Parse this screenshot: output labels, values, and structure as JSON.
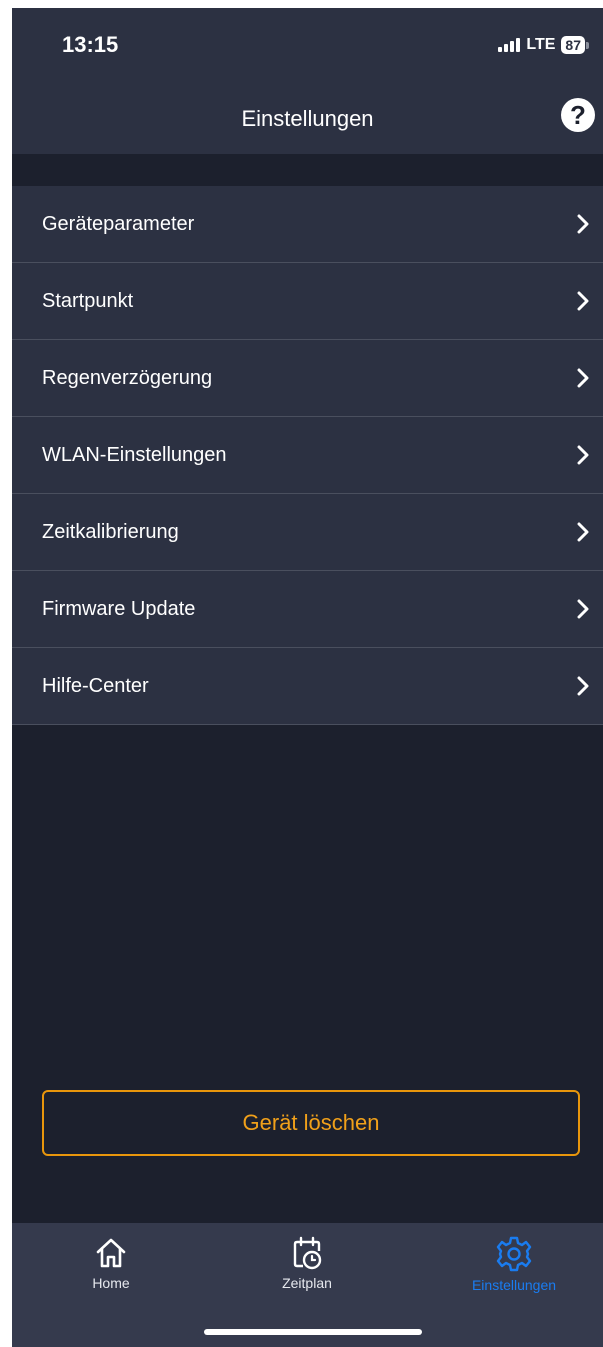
{
  "status_bar": {
    "time": "13:15",
    "network": "LTE",
    "battery": "87"
  },
  "header": {
    "title": "Einstellungen",
    "help_icon": "question-circle-icon",
    "help_glyph": "?"
  },
  "menu": {
    "items": [
      {
        "label": "Geräteparameter"
      },
      {
        "label": "Startpunkt"
      },
      {
        "label": "Regenverzögerung"
      },
      {
        "label": "WLAN-Einstellungen"
      },
      {
        "label": "Zeitkalibrierung"
      },
      {
        "label": "Firmware Update"
      },
      {
        "label": "Hilfe-Center"
      }
    ]
  },
  "actions": {
    "delete_label": "Gerät löschen"
  },
  "tabbar": {
    "tabs": [
      {
        "label": "Home",
        "icon": "home-icon",
        "active": false
      },
      {
        "label": "Zeitplan",
        "icon": "calendar-clock-icon",
        "active": false
      },
      {
        "label": "Einstellungen",
        "icon": "gear-icon",
        "active": true
      }
    ]
  },
  "colors": {
    "background": "#1c202d",
    "surface": "#2c3142",
    "tabbar": "#353a4d",
    "accent": "#1a7cf0",
    "warning": "#e8960c"
  }
}
